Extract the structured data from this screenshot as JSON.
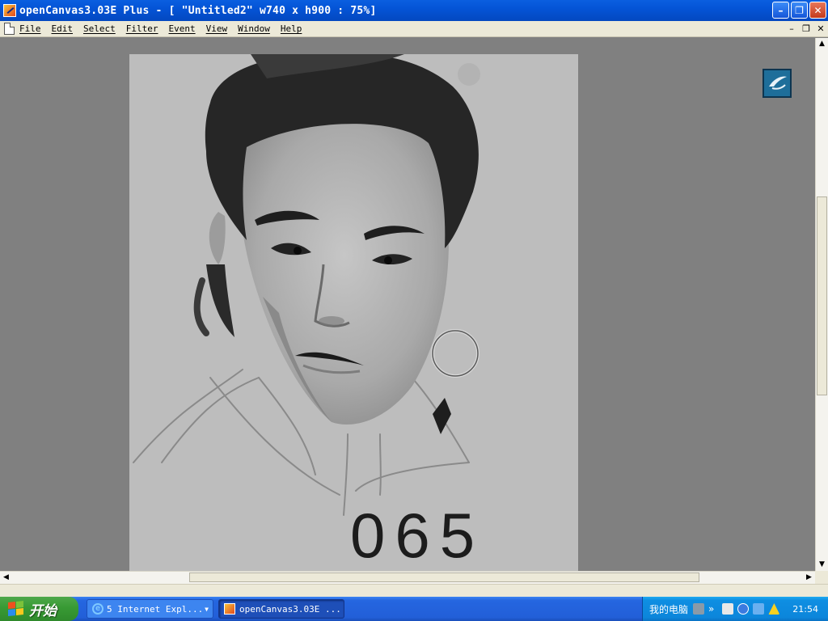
{
  "window": {
    "title": "openCanvas3.03E Plus - [ \"Untitled2\" w740 x h900 : 75%]"
  },
  "menu": {
    "items": [
      "File",
      "Edit",
      "Select",
      "Filter",
      "Event",
      "View",
      "Window",
      "Help"
    ]
  },
  "window_buttons": {
    "minimize": "–",
    "maximize": "❐",
    "close": "✕"
  },
  "mdi_buttons": {
    "minimize": "–",
    "restore": "❐",
    "close": "✕"
  },
  "canvas": {
    "drawing_text": "065",
    "background_color": "#bdbdbd"
  },
  "scrollbars": {
    "up": "▲",
    "down": "▼",
    "left": "◀",
    "right": "▶"
  },
  "taskbar": {
    "start_label": "开始",
    "tasks": [
      {
        "label": "5 Internet Expl...",
        "icon": "ie-icon",
        "arrow": "▼"
      },
      {
        "label": "openCanvas3.03E ...",
        "icon": "opencanvas-icon"
      }
    ],
    "tray_label": "我的电脑",
    "tray_extra": "»",
    "clock": "21:54"
  },
  "colors": {
    "titlebar": "#0454d6",
    "workspace": "#808080",
    "taskbar": "#225fd8",
    "start": "#389a34"
  }
}
